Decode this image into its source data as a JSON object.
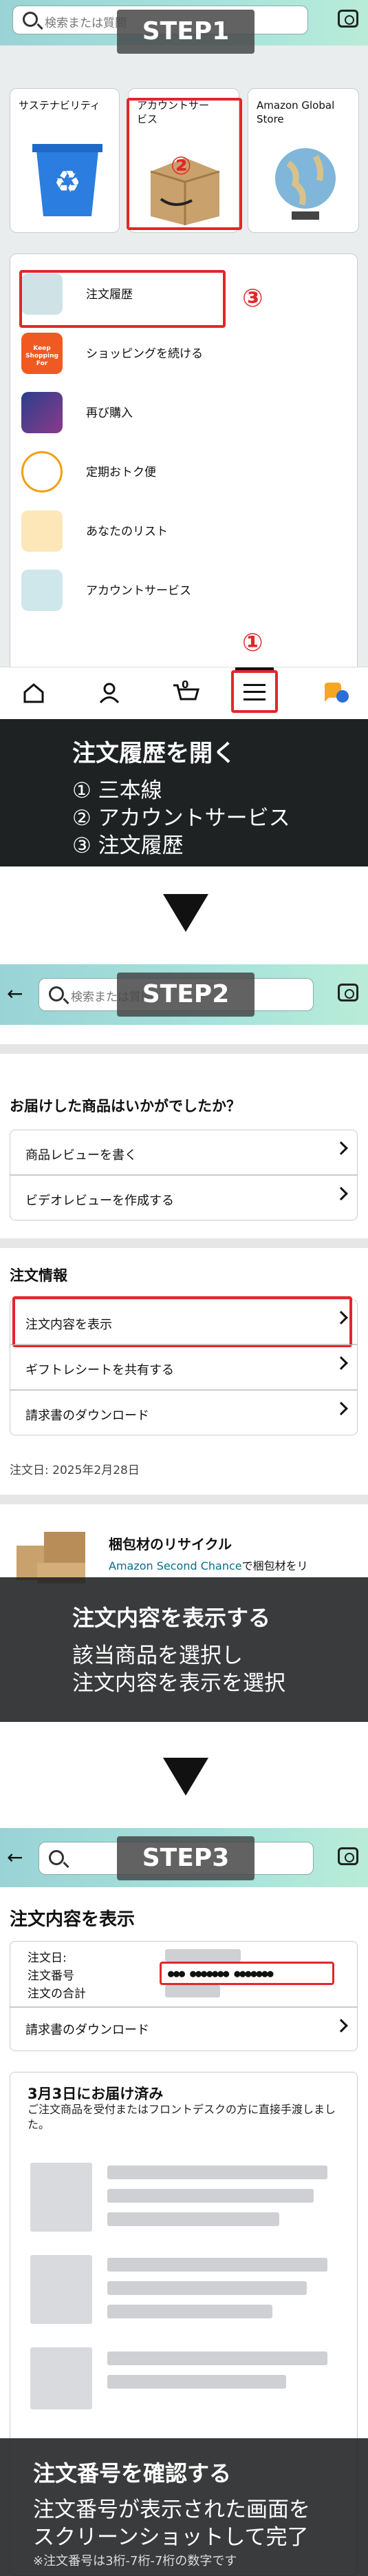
{
  "search_placeholder": "検索または質問",
  "steps": {
    "s1": "STEP1",
    "s2": "STEP2",
    "s3": "STEP3"
  },
  "tiles": {
    "sustainability": "サステナビリティ",
    "account_service": "アカウントサービス",
    "global_store": "Amazon Global Store"
  },
  "menu": [
    "注文履歴",
    "ショッピングを続ける",
    "再び購入",
    "定期おトク便",
    "あなたのリスト",
    "アカウントサービス"
  ],
  "keep_shopping_icon": "Keep Shopping For",
  "markers": {
    "one": "①",
    "two": "②",
    "three": "③"
  },
  "nav_icons": [
    "home-icon",
    "person-icon",
    "cart-icon",
    "menu-icon",
    "assistant-icon"
  ],
  "cart_count": "0",
  "step1_caption": {
    "title": "注文履歴を開く",
    "lines": [
      "① 三本線",
      "② アカウントサービス",
      "③ 注文履歴"
    ]
  },
  "step2": {
    "review_header": "お届けした商品はいかがでしたか？",
    "review_rows": [
      "商品レビューを書く",
      "ビデオレビューを作成する"
    ],
    "order_info": "注文情報",
    "order_rows": [
      "注文内容を表示",
      "ギフトレシートを共有する",
      "請求書のダウンロード"
    ],
    "order_date": "注文日: 2025年2月28日",
    "recycle_title": "梱包材のリサイクル",
    "recycle_link": "Amazon Second Chance",
    "recycle_text": "で梱包材をリ",
    "caption": {
      "title": "注文内容を表示する",
      "lines": [
        "該当商品を選択し",
        "注文内容を表示を選択"
      ]
    }
  },
  "step3": {
    "title": "注文内容を表示",
    "labels": [
      "注文日",
      "注文番号",
      "注文の合計"
    ],
    "order_number": "●●● ●●●●●●● ●●●●●●●",
    "invoice": "請求書のダウンロード",
    "delivered": "3月3日にお届け済み",
    "delivered_note": "ご注文商品を受付またはフロントデスクの方に直接手渡しました。",
    "caption": {
      "title": "注文番号を確認する",
      "lines": [
        "注文番号が表示された画面を",
        "スクリーンショットして完了"
      ],
      "note": "※注文番号は3桁-7桁-7桁の数字です"
    }
  }
}
